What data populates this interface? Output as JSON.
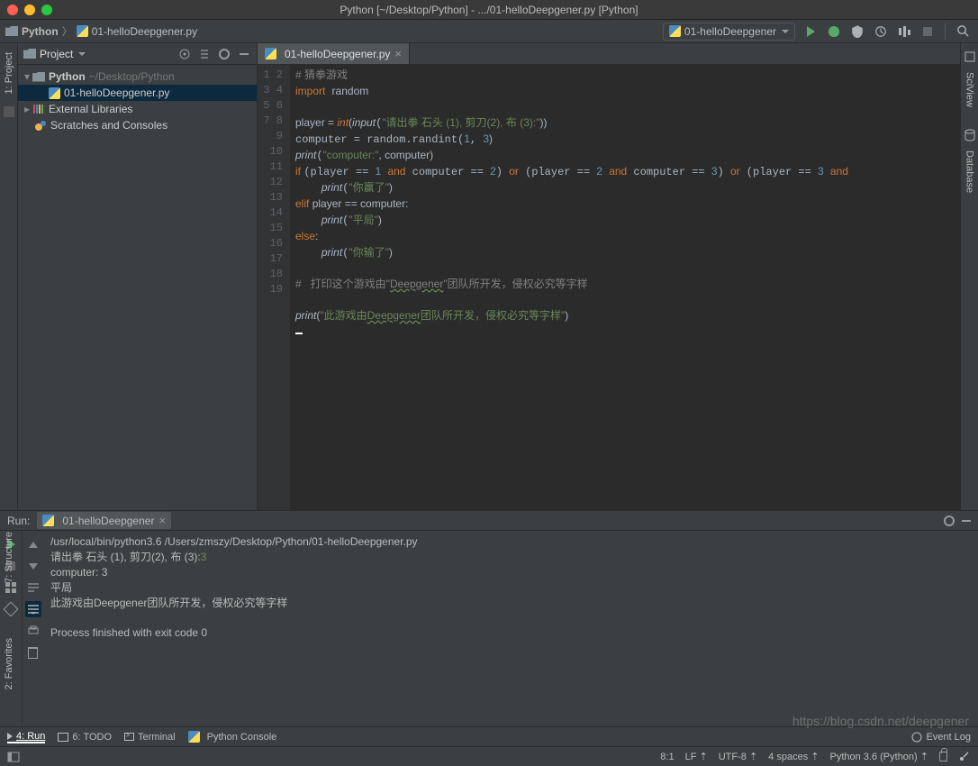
{
  "title": "Python [~/Desktop/Python] - .../01-helloDeepgener.py [Python]",
  "breadcrumb": {
    "project": "Python",
    "file": "01-helloDeepgener.py"
  },
  "config": {
    "name": "01-helloDeepgener"
  },
  "projectPanel": {
    "title": "Project",
    "root": "Python",
    "rootPath": "~/Desktop/Python",
    "file": "01-helloDeepgener.py",
    "external": "External Libraries",
    "scratches": "Scratches and Consoles"
  },
  "editorTab": "01-helloDeepgener.py",
  "lines": [
    "1",
    "2",
    "3",
    "4",
    "5",
    "6",
    "7",
    "8",
    "9",
    "10",
    "11",
    "12",
    "13",
    "14",
    "15",
    "16",
    "17",
    "18",
    "19"
  ],
  "code": {
    "l1": "# 猜拳游戏",
    "l2_import": "import",
    "l2_mod": "random",
    "l4_var": "player = ",
    "l4_int": "int",
    "l4_open": "(",
    "l4_input": "input",
    "l4_s": "\"请出拳 石头 (1), 剪刀(2), 布 (3):\"",
    "l4_close": "))",
    "l5": "computer = random.randint(",
    "l5_a": "1",
    "l5_b": "3",
    "l5_c": ")",
    "l6_print": "print",
    "l6_s": "\"computer:\"",
    "l6_rest": ", computer)",
    "l7_if": "if ",
    "l7_expr1": "(player == ",
    "l7_n1": "1",
    "l7_and": " and ",
    "l7_expr2": "computer == ",
    "l7_n2": "2",
    "l7_or": ") or ",
    "l7_expr3": "(player == ",
    "l7_n3": "2",
    "l7_expr4": "computer == ",
    "l7_n4": "3",
    "l7_expr5": "(player == ",
    "l7_n5": "3",
    "l7_andstr": "and",
    "l8": "    print(",
    "l8_s": "\"你赢了\"",
    "l8_c": ")",
    "l9_elif": "elif ",
    "l9_expr": "player == computer:",
    "l10": "    print(",
    "l10_s": "\"平局\"",
    "l10_c": ")",
    "l11_else": "else",
    "l11_c": ":",
    "l12": "    print(",
    "l12_s": "\"你输了\"",
    "l12_c": ")",
    "l14": "#   打印这个游戏由\"Deepgener\"团队所开发，侵权必究等字样",
    "l16_p": "print",
    "l16_o": "(",
    "l16_s": "\"此游戏由Deepgener团队所开发，侵权必究等字样\"",
    "l16_c": ")"
  },
  "rightStrips": {
    "sci": "SciView",
    "db": "Database"
  },
  "leftStrips": {
    "proj": "1: Project",
    "struct": "7: Structure",
    "fav": "2: Favorites"
  },
  "run": {
    "label": "Run:",
    "tab": "01-helloDeepgener",
    "out1": "/usr/local/bin/python3.6 /Users/zmszy/Desktop/Python/01-helloDeepgener.py",
    "out2": "请出拳 石头 (1), 剪刀(2), 布 (3):",
    "out2g": "3",
    "out3": "computer: 3",
    "out4": "平局",
    "out5": "此游戏由Deepgener团队所开发，侵权必究等字样",
    "out6": "Process finished with exit code 0"
  },
  "bottomTools": {
    "run": "4: Run",
    "todo": "6: TODO",
    "terminal": "Terminal",
    "pyconsole": "Python Console",
    "eventlog": "Event Log"
  },
  "status": {
    "pos": "8:1",
    "lf": "LF",
    "enc": "UTF-8",
    "indent": "4 spaces",
    "sdk": "Python 3.6 (Python)"
  },
  "watermark": "https://blog.csdn.net/deepgener"
}
